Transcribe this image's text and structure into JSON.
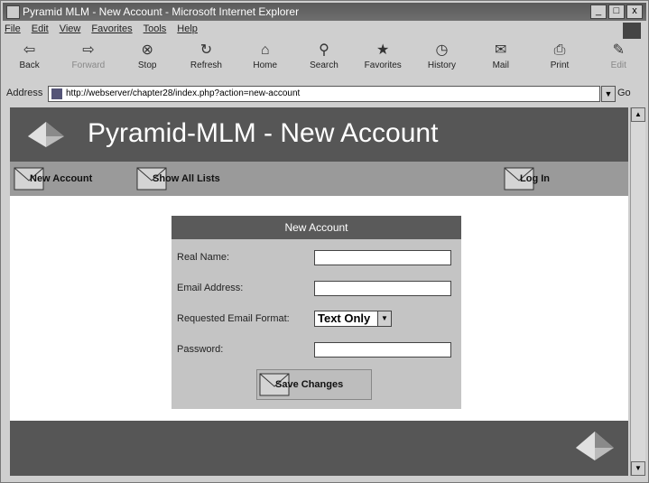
{
  "window": {
    "title": "Pyramid MLM - New Account - Microsoft Internet Explorer",
    "controls": [
      "_",
      "□",
      "x"
    ]
  },
  "menu": [
    "File",
    "Edit",
    "View",
    "Favorites",
    "Tools",
    "Help"
  ],
  "toolbar": [
    {
      "label": "Back",
      "icon": "back-arrow-icon"
    },
    {
      "label": "Forward",
      "icon": "forward-arrow-icon"
    },
    {
      "label": "Stop",
      "icon": "stop-icon"
    },
    {
      "label": "Refresh",
      "icon": "refresh-icon"
    },
    {
      "label": "Home",
      "icon": "home-icon"
    },
    {
      "label": "Search",
      "icon": "search-icon"
    },
    {
      "label": "Favorites",
      "icon": "favorites-icon"
    },
    {
      "label": "History",
      "icon": "history-icon"
    },
    {
      "label": "Mail",
      "icon": "mail-icon"
    },
    {
      "label": "Print",
      "icon": "print-icon"
    },
    {
      "label": "Edit",
      "icon": "edit-icon"
    }
  ],
  "address": {
    "label": "Address",
    "url": "http://webserver/chapter28/index.php?action=new-account",
    "go": "Go"
  },
  "page": {
    "title": "Pyramid-MLM - New Account",
    "nav": {
      "new_account": "New Account",
      "show_all_lists": "Show All Lists",
      "log_in": "Log In"
    },
    "form": {
      "header": "New Account",
      "real_name_label": "Real Name:",
      "email_label": "Email Address:",
      "format_label": "Requested Email Format:",
      "format_value": "Text Only",
      "password_label": "Password:",
      "save_label": "Save Changes"
    }
  },
  "colors": {
    "banner": "#565656",
    "nav": "#9a9a9a",
    "form_panel": "#c4c4c4"
  }
}
